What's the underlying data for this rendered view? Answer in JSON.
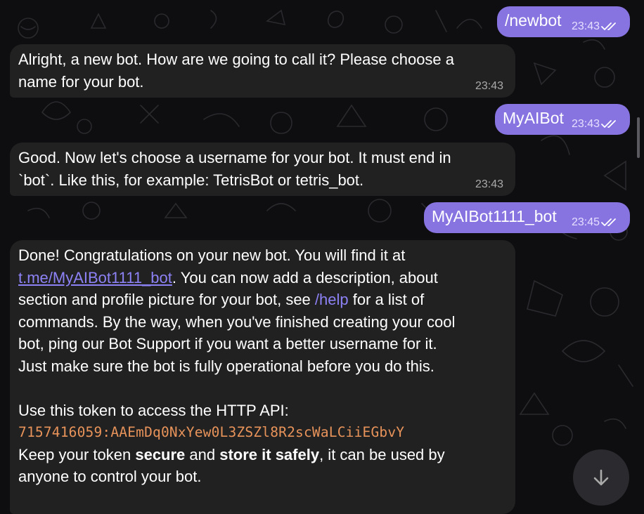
{
  "colors": {
    "background": "#0e0e10",
    "incoming_bubble": "#212121",
    "outgoing_bubble": "#8774e1",
    "link": "#8d82f5",
    "token": "#e8935a"
  },
  "messages": [
    {
      "dir": "out",
      "text": "/newbot",
      "time": "23:43",
      "status": "read-double-check-icon"
    },
    {
      "dir": "in",
      "lines": [
        "Alright, a new bot. How are we going to call it? Please choose a",
        "name for your bot."
      ],
      "time": "23:43"
    },
    {
      "dir": "out",
      "text": "MyAIBot",
      "time": "23:43",
      "status": "read-double-check-icon"
    },
    {
      "dir": "in",
      "lines": [
        "Good. Now let's choose a username for your bot. It must end in",
        "`bot`. Like this, for example: TetrisBot or tetris_bot."
      ],
      "time": "23:43"
    },
    {
      "dir": "out",
      "text": "MyAIBot1111_bot",
      "time": "23:45",
      "status": "read-double-check-icon"
    },
    {
      "dir": "in",
      "line1": "Done! Congratulations on your new bot. You will find it at",
      "link": "t.me/MyAIBot1111_bot",
      "line2_after_link": ". You can now add a description, about",
      "line3_before_cmd": "section and profile picture for your bot, see ",
      "cmd": "/help",
      "line3_after_cmd": " for a list of",
      "line4": "commands. By the way, when you've finished creating your cool",
      "line5": "bot, ping our Bot Support if you want a better username for it.",
      "line6": "Just make sure the bot is fully operational before you do this.",
      "token_label": "Use this token to access the HTTP API:",
      "token": "7157416059:AAEmDq0NxYew0L3ZSZl8R2scWaLCiiEGbvY",
      "secure_pre": "Keep your token ",
      "secure_bold": "secure",
      "secure_mid": " and ",
      "store_bold": "store it safely",
      "secure_post": ", it can be used by",
      "last_line": "anyone to control your bot."
    }
  ],
  "scroll_button_icon": "arrow-down-icon"
}
